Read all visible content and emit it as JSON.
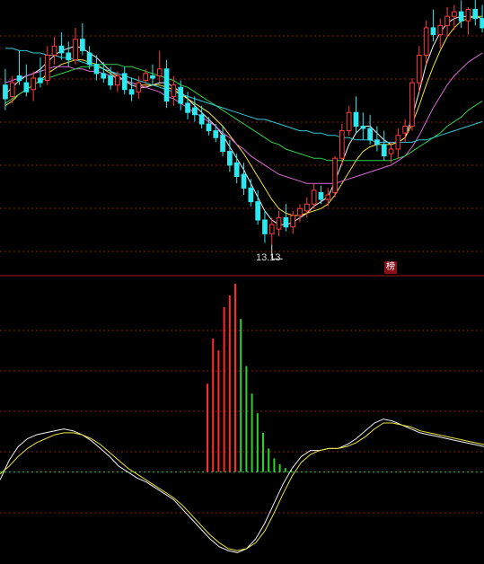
{
  "chart_data": [
    {
      "type": "candlestick",
      "panel": "price",
      "title": "",
      "ylim": [
        12.2,
        23.5
      ],
      "colors": {
        "up": "#ff3b3b",
        "down": "#2ee8f0",
        "grid": "#8c1c1c",
        "separator": "#a01818"
      },
      "low_annotation": "13.13",
      "badge": "榜",
      "candles": [
        {
          "o": 20.1,
          "h": 20.8,
          "l": 19.0,
          "c": 19.5
        },
        {
          "o": 19.6,
          "h": 20.5,
          "l": 19.3,
          "c": 20.2
        },
        {
          "o": 20.5,
          "h": 21.6,
          "l": 20.1,
          "c": 20.3
        },
        {
          "o": 20.2,
          "h": 21.0,
          "l": 19.6,
          "c": 19.8
        },
        {
          "o": 19.9,
          "h": 20.7,
          "l": 19.4,
          "c": 20.4
        },
        {
          "o": 20.4,
          "h": 21.3,
          "l": 20.0,
          "c": 20.2
        },
        {
          "o": 20.3,
          "h": 21.8,
          "l": 20.1,
          "c": 21.4
        },
        {
          "o": 21.4,
          "h": 22.2,
          "l": 21.0,
          "c": 21.8
        },
        {
          "o": 21.8,
          "h": 22.4,
          "l": 21.2,
          "c": 21.5
        },
        {
          "o": 21.5,
          "h": 22.0,
          "l": 20.9,
          "c": 21.2
        },
        {
          "o": 21.2,
          "h": 22.6,
          "l": 21.0,
          "c": 22.1
        },
        {
          "o": 22.1,
          "h": 22.8,
          "l": 21.4,
          "c": 21.6
        },
        {
          "o": 21.5,
          "h": 21.8,
          "l": 20.8,
          "c": 21.0
        },
        {
          "o": 21.0,
          "h": 21.4,
          "l": 20.3,
          "c": 20.6
        },
        {
          "o": 20.6,
          "h": 21.1,
          "l": 20.2,
          "c": 20.4
        },
        {
          "o": 20.5,
          "h": 20.9,
          "l": 19.9,
          "c": 20.1
        },
        {
          "o": 20.1,
          "h": 20.7,
          "l": 19.8,
          "c": 20.5
        },
        {
          "o": 20.6,
          "h": 20.9,
          "l": 19.7,
          "c": 19.9
        },
        {
          "o": 19.9,
          "h": 20.4,
          "l": 19.4,
          "c": 19.7
        },
        {
          "o": 19.8,
          "h": 20.5,
          "l": 19.5,
          "c": 20.2
        },
        {
          "o": 20.3,
          "h": 20.8,
          "l": 20.0,
          "c": 20.6
        },
        {
          "o": 20.5,
          "h": 21.0,
          "l": 20.1,
          "c": 20.4
        },
        {
          "o": 20.5,
          "h": 21.6,
          "l": 20.2,
          "c": 20.8
        },
        {
          "o": 20.8,
          "h": 21.2,
          "l": 19.1,
          "c": 19.4
        },
        {
          "o": 19.6,
          "h": 20.5,
          "l": 19.2,
          "c": 20.1
        },
        {
          "o": 20.0,
          "h": 20.3,
          "l": 19.0,
          "c": 19.3
        },
        {
          "o": 19.3,
          "h": 19.8,
          "l": 18.6,
          "c": 18.9
        },
        {
          "o": 19.1,
          "h": 19.6,
          "l": 18.5,
          "c": 18.8
        },
        {
          "o": 18.8,
          "h": 19.2,
          "l": 18.2,
          "c": 18.4
        },
        {
          "o": 18.4,
          "h": 18.7,
          "l": 17.9,
          "c": 18.1
        },
        {
          "o": 18.1,
          "h": 18.4,
          "l": 17.6,
          "c": 17.8
        },
        {
          "o": 17.9,
          "h": 18.3,
          "l": 17.0,
          "c": 17.2
        },
        {
          "o": 17.2,
          "h": 17.7,
          "l": 16.3,
          "c": 16.6
        },
        {
          "o": 16.7,
          "h": 17.1,
          "l": 15.8,
          "c": 16.1
        },
        {
          "o": 16.2,
          "h": 16.7,
          "l": 15.3,
          "c": 15.6
        },
        {
          "o": 15.6,
          "h": 16.0,
          "l": 14.8,
          "c": 15.0
        },
        {
          "o": 15.0,
          "h": 15.5,
          "l": 14.0,
          "c": 14.2
        },
        {
          "o": 14.2,
          "h": 14.6,
          "l": 13.2,
          "c": 13.6
        },
        {
          "o": 13.6,
          "h": 14.3,
          "l": 13.13,
          "c": 14.0
        },
        {
          "o": 13.8,
          "h": 14.6,
          "l": 13.5,
          "c": 14.3
        },
        {
          "o": 14.3,
          "h": 14.9,
          "l": 13.7,
          "c": 13.9
        },
        {
          "o": 13.9,
          "h": 14.6,
          "l": 13.6,
          "c": 14.4
        },
        {
          "o": 14.4,
          "h": 14.9,
          "l": 14.1,
          "c": 14.7
        },
        {
          "o": 14.6,
          "h": 15.2,
          "l": 14.3,
          "c": 14.9
        },
        {
          "o": 14.9,
          "h": 15.8,
          "l": 14.7,
          "c": 15.5
        },
        {
          "o": 15.4,
          "h": 15.7,
          "l": 14.9,
          "c": 15.1
        },
        {
          "o": 15.1,
          "h": 15.6,
          "l": 14.8,
          "c": 15.3
        },
        {
          "o": 15.4,
          "h": 17.0,
          "l": 15.2,
          "c": 16.9
        },
        {
          "o": 16.9,
          "h": 18.4,
          "l": 16.6,
          "c": 18.1
        },
        {
          "o": 18.1,
          "h": 19.2,
          "l": 17.9,
          "c": 18.9
        },
        {
          "o": 18.9,
          "h": 19.6,
          "l": 18.0,
          "c": 18.3
        },
        {
          "o": 18.3,
          "h": 18.9,
          "l": 17.7,
          "c": 18.2
        },
        {
          "o": 18.2,
          "h": 18.8,
          "l": 17.5,
          "c": 17.7
        },
        {
          "o": 17.7,
          "h": 18.3,
          "l": 17.2,
          "c": 17.5
        },
        {
          "o": 17.5,
          "h": 18.1,
          "l": 16.8,
          "c": 17.0
        },
        {
          "o": 17.1,
          "h": 17.6,
          "l": 16.7,
          "c": 17.3
        },
        {
          "o": 17.3,
          "h": 18.2,
          "l": 16.9,
          "c": 17.9
        },
        {
          "o": 18.0,
          "h": 18.6,
          "l": 17.6,
          "c": 18.3
        },
        {
          "o": 18.3,
          "h": 20.4,
          "l": 18.1,
          "c": 20.2
        },
        {
          "o": 20.2,
          "h": 21.8,
          "l": 19.8,
          "c": 21.4
        },
        {
          "o": 21.4,
          "h": 22.9,
          "l": 21.0,
          "c": 22.6
        },
        {
          "o": 22.6,
          "h": 23.4,
          "l": 22.0,
          "c": 22.3
        },
        {
          "o": 22.3,
          "h": 23.0,
          "l": 21.7,
          "c": 22.7
        },
        {
          "o": 22.7,
          "h": 23.5,
          "l": 22.2,
          "c": 23.1
        },
        {
          "o": 23.1,
          "h": 23.6,
          "l": 22.5,
          "c": 23.3
        },
        {
          "o": 23.3,
          "h": 23.8,
          "l": 22.6,
          "c": 22.9
        },
        {
          "o": 22.9,
          "h": 23.5,
          "l": 22.3,
          "c": 23.4
        },
        {
          "o": 23.4,
          "h": 23.9,
          "l": 22.7,
          "c": 23.0
        },
        {
          "o": 23.0,
          "h": 23.6,
          "l": 22.4,
          "c": 22.6
        }
      ],
      "ma_lines": [
        {
          "color": "#f2f2f2",
          "values": [
            19.7,
            20.0,
            20.3,
            20.5,
            20.6,
            20.8,
            21.1,
            21.4,
            21.6,
            21.7,
            21.8,
            21.7,
            21.5,
            21.3,
            21.0,
            20.7,
            20.5,
            20.3,
            20.1,
            20.0,
            20.0,
            20.1,
            20.2,
            20.2,
            20.0,
            19.8,
            19.5,
            19.2,
            18.9,
            18.6,
            18.3,
            17.9,
            17.4,
            16.9,
            16.4,
            15.8,
            15.2,
            14.6,
            14.2,
            14.0,
            14.0,
            14.1,
            14.3,
            14.5,
            14.8,
            15.0,
            15.2,
            15.9,
            16.7,
            17.5,
            18.0,
            18.3,
            18.3,
            18.0,
            17.7,
            17.5,
            17.6,
            17.8,
            18.7,
            19.8,
            21.0,
            21.8,
            22.4,
            22.8,
            23.0,
            23.1,
            23.1,
            23.1,
            23.0
          ]
        },
        {
          "color": "#f3e23c",
          "values": [
            19.2,
            19.4,
            19.7,
            19.9,
            20.1,
            20.3,
            20.6,
            20.8,
            21.0,
            21.1,
            21.2,
            21.2,
            21.1,
            21.0,
            20.8,
            20.6,
            20.4,
            20.3,
            20.2,
            20.1,
            20.1,
            20.1,
            20.1,
            20.0,
            19.9,
            19.7,
            19.5,
            19.3,
            19.1,
            18.9,
            18.6,
            18.3,
            17.9,
            17.5,
            17.1,
            16.6,
            16.1,
            15.6,
            15.1,
            14.7,
            14.5,
            14.4,
            14.4,
            14.5,
            14.6,
            14.7,
            14.9,
            15.3,
            15.8,
            16.3,
            16.8,
            17.2,
            17.4,
            17.5,
            17.5,
            17.5,
            17.6,
            17.8,
            18.4,
            19.2,
            20.1,
            20.9,
            21.6,
            22.2,
            22.6,
            22.9,
            23.0,
            23.1,
            23.1
          ]
        },
        {
          "color": "#d96ad9",
          "values": [
            20.2,
            20.3,
            20.4,
            20.5,
            20.6,
            20.7,
            20.8,
            20.9,
            20.9,
            20.9,
            20.8,
            20.8,
            20.7,
            20.7,
            20.6,
            20.5,
            20.4,
            20.3,
            20.2,
            20.1,
            20.0,
            19.9,
            19.8,
            19.6,
            19.5,
            19.3,
            19.1,
            18.9,
            18.7,
            18.5,
            18.3,
            18.0,
            17.8,
            17.5,
            17.3,
            17.0,
            16.8,
            16.6,
            16.4,
            16.2,
            16.1,
            16.0,
            15.9,
            15.8,
            15.8,
            15.8,
            15.8,
            15.8,
            15.9,
            16.0,
            16.1,
            16.2,
            16.3,
            16.4,
            16.5,
            16.6,
            16.8,
            17.0,
            17.4,
            17.9,
            18.5,
            19.1,
            19.6,
            20.1,
            20.5,
            20.8,
            21.1,
            21.3,
            21.5
          ]
        },
        {
          "color": "#2fd14a",
          "values": [
            19.3,
            19.5,
            19.7,
            19.9,
            20.1,
            20.3,
            20.4,
            20.5,
            20.6,
            20.7,
            20.8,
            20.9,
            20.9,
            21.0,
            21.0,
            21.0,
            21.0,
            20.9,
            20.9,
            20.8,
            20.7,
            20.6,
            20.5,
            20.4,
            20.3,
            20.1,
            20.0,
            19.8,
            19.6,
            19.4,
            19.2,
            19.0,
            18.8,
            18.6,
            18.4,
            18.2,
            18.0,
            17.8,
            17.6,
            17.5,
            17.3,
            17.2,
            17.1,
            17.0,
            16.9,
            16.9,
            16.8,
            16.8,
            16.8,
            16.8,
            16.8,
            16.8,
            16.8,
            16.8,
            16.8,
            16.8,
            16.9,
            17.0,
            17.2,
            17.4,
            17.6,
            17.8,
            18.0,
            18.3,
            18.5,
            18.7,
            19.0,
            19.2,
            19.4
          ]
        },
        {
          "color": "#33c9d6",
          "values": [
            21.7,
            21.7,
            21.6,
            21.6,
            21.5,
            21.5,
            21.4,
            21.4,
            21.3,
            21.3,
            21.2,
            21.1,
            21.0,
            20.9,
            20.8,
            20.7,
            20.6,
            20.5,
            20.4,
            20.3,
            20.2,
            20.1,
            20.0,
            19.9,
            19.8,
            19.7,
            19.6,
            19.5,
            19.4,
            19.3,
            19.2,
            19.1,
            19.0,
            18.9,
            18.8,
            18.7,
            18.6,
            18.6,
            18.5,
            18.4,
            18.3,
            18.2,
            18.1,
            18.1,
            18.0,
            18.0,
            17.9,
            17.9,
            17.8,
            17.8,
            17.7,
            17.7,
            17.7,
            17.6,
            17.6,
            17.6,
            17.6,
            17.6,
            17.6,
            17.7,
            17.7,
            17.8,
            17.9,
            18.0,
            18.1,
            18.2,
            18.3,
            18.4,
            18.5
          ]
        }
      ]
    },
    {
      "type": "bar+line",
      "panel": "indicator",
      "title": "",
      "ylim": [
        -45,
        95
      ],
      "zero_line": true,
      "histogram": [
        {
          "value": 45
        },
        {
          "value": 68
        },
        {
          "value": 62
        },
        {
          "value": 84
        },
        {
          "value": 90
        },
        {
          "value": 96
        },
        {
          "value": 78
        },
        {
          "value": 54
        },
        {
          "value": 40
        },
        {
          "value": 30
        },
        {
          "value": 20
        },
        {
          "value": 12
        },
        {
          "value": 7
        },
        {
          "value": 4
        },
        {
          "value": 2
        },
        {
          "value": 1
        }
      ],
      "histogram_colors": [
        "#ff2a2a",
        "#ff2a2a",
        "#ff2a2a",
        "#ff2a2a",
        "#ff2a2a",
        "#ff2a2a",
        "#2bd22b",
        "#2bd22b",
        "#2bd22b",
        "#2bd22b",
        "#2bd22b",
        "#2bd22b",
        "#2bd22b",
        "#2bd22b",
        "#2bd22b",
        "#2bd22b"
      ],
      "series": [
        {
          "color": "#f2f2f2",
          "values": [
            -4,
            6,
            13,
            17,
            19,
            20,
            21,
            22,
            21,
            19,
            16,
            12,
            8,
            3,
            0,
            -3,
            -5,
            -8,
            -11,
            -14,
            -19,
            -24,
            -29,
            -34,
            -38,
            -40,
            -41,
            -39,
            -34,
            -26,
            -16,
            -6,
            2,
            8,
            11,
            11,
            12,
            12,
            14,
            17,
            21,
            25,
            27,
            26,
            24,
            22,
            20,
            19,
            18,
            17,
            16,
            15,
            14,
            13
          ]
        },
        {
          "color": "#e9e23c",
          "values": [
            -1,
            3,
            8,
            12,
            15,
            17,
            19,
            20,
            20,
            19,
            17,
            14,
            10,
            6,
            2,
            -1,
            -4,
            -7,
            -10,
            -13,
            -17,
            -22,
            -27,
            -32,
            -36,
            -39,
            -40,
            -39,
            -36,
            -30,
            -21,
            -11,
            -2,
            5,
            9,
            11,
            12,
            12,
            13,
            15,
            18,
            22,
            25,
            25,
            24,
            23,
            21,
            20,
            19,
            18,
            17,
            16,
            15,
            14
          ]
        }
      ]
    }
  ]
}
